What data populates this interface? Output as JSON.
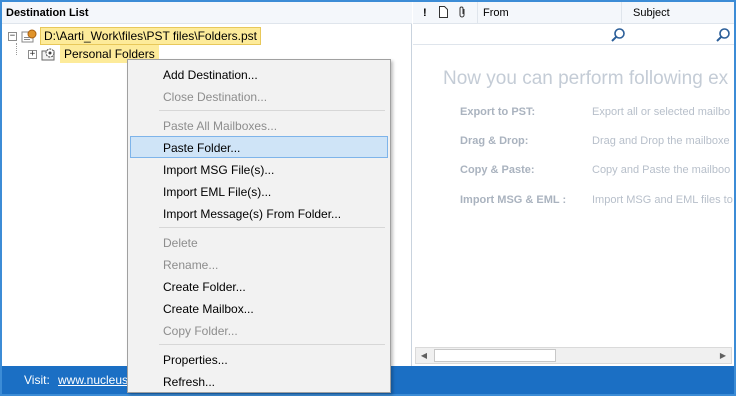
{
  "left_pane": {
    "header": "Destination List",
    "tree": {
      "root_label": "D:\\Aarti_Work\\files\\PST files\\Folders.pst",
      "child_label": "Personal Folders"
    }
  },
  "right_pane": {
    "columns": [
      "!",
      "From",
      "Subject"
    ],
    "promo_title": "Now you can perform following ex",
    "features": [
      {
        "name": "Export to PST:",
        "desc": "Export all or selected mailbo"
      },
      {
        "name": "Drag & Drop:",
        "desc": "Drag and Drop the mailboxe"
      },
      {
        "name": "Copy & Paste:",
        "desc": "Copy and Paste the mailboo"
      },
      {
        "name": "Import MSG & EML :",
        "desc": "Import MSG and EML files to"
      }
    ]
  },
  "status_bar": {
    "visit_label": "Visit:",
    "link_text": "www.nucleus"
  },
  "context_menu": {
    "items": [
      {
        "label": "Add Destination...",
        "enabled": true
      },
      {
        "label": "Close Destination...",
        "enabled": false
      },
      {
        "label": "Paste All Mailboxes...",
        "enabled": false
      },
      {
        "label": "Paste Folder...",
        "enabled": true,
        "highlighted": true
      },
      {
        "label": "Import MSG File(s)...",
        "enabled": true
      },
      {
        "label": "Import EML File(s)...",
        "enabled": true
      },
      {
        "label": "Import Message(s) From Folder...",
        "enabled": true
      },
      {
        "label": "Delete",
        "enabled": false
      },
      {
        "label": "Rename...",
        "enabled": false
      },
      {
        "label": "Create Folder...",
        "enabled": true
      },
      {
        "label": "Create Mailbox...",
        "enabled": true
      },
      {
        "label": "Copy Folder...",
        "enabled": false
      },
      {
        "label": "Properties...",
        "enabled": true
      },
      {
        "label": "Refresh...",
        "enabled": true
      }
    ]
  },
  "icons": {
    "pst_file": "pst-file-icon",
    "personal_folders": "folder-gear-icon",
    "attachment": "paperclip-icon",
    "document": "document-icon",
    "search": "search-icon"
  },
  "colors": {
    "highlight": "#cfe4f7",
    "status_bar": "#1b6fc4",
    "tree_selection": "#fdeb9a"
  }
}
